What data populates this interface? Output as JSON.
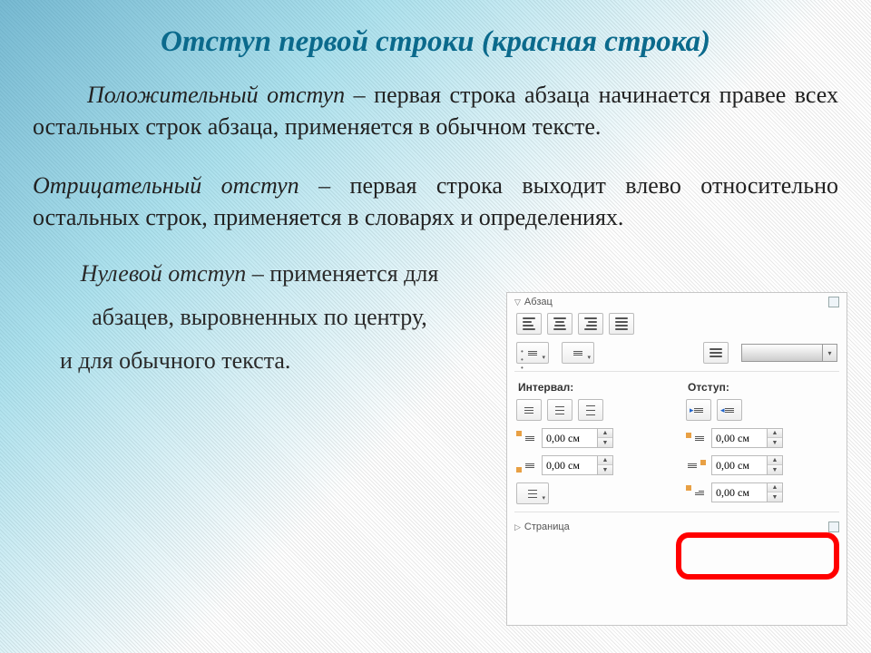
{
  "title": "Отступ первой строки (красная строка)",
  "para1": {
    "term": "Положительный отступ",
    "rest": " – первая строка абзаца начинается правее всех остальных строк абзаца, применяется в обычном тексте."
  },
  "para2": {
    "term": "Отрицательный отступ",
    "rest": " – первая строка выходит влево относительно остальных строк, применяется в словарях и определениях."
  },
  "para3": {
    "term": "Нулевой отступ",
    "rest1": " – применяется для",
    "l2": "абзацев, выровненных по центру,",
    "l3": "и для обычного текста."
  },
  "panel": {
    "section1": "Абзац",
    "section2": "Страница",
    "label_interval": "Интервал:",
    "label_indent": "Отступ:",
    "val_spacing_before": "0,00 см",
    "val_spacing_after": "0,00 см",
    "val_indent_left": "0,00 см",
    "val_indent_right": "0,00 см",
    "val_indent_first": "0,00 см"
  }
}
